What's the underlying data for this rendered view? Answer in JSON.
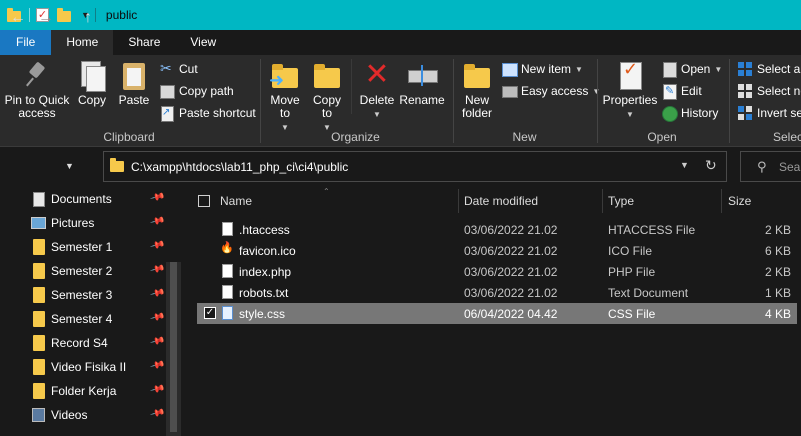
{
  "window": {
    "title": "public",
    "accent_color": "#00b7c3"
  },
  "tabs": [
    {
      "label": "File"
    },
    {
      "label": "Home"
    },
    {
      "label": "Share"
    },
    {
      "label": "View"
    }
  ],
  "ribbon": {
    "clipboard": {
      "label": "Clipboard",
      "pin": "Pin to Quick access",
      "copy": "Copy",
      "paste": "Paste",
      "cut": "Cut",
      "copy_path": "Copy path",
      "paste_shortcut": "Paste shortcut"
    },
    "organize": {
      "label": "Organize",
      "move_to": "Move to",
      "copy_to": "Copy to",
      "delete": "Delete",
      "rename": "Rename"
    },
    "new": {
      "label": "New",
      "new_folder": "New folder",
      "new_item": "New item",
      "easy_access": "Easy access"
    },
    "open": {
      "label": "Open",
      "properties": "Properties",
      "open": "Open",
      "edit": "Edit",
      "history": "History"
    },
    "select": {
      "label": "Select",
      "select_all": "Select all",
      "select_none": "Select none",
      "invert_selection": "Invert selection"
    }
  },
  "address": {
    "path": "C:\\xampp\\htdocs\\lab11_php_ci\\ci4\\public",
    "search_placeholder": "Search"
  },
  "sidebar": {
    "items": [
      {
        "label": "Documents",
        "icon": "documents-icon"
      },
      {
        "label": "Pictures",
        "icon": "pictures-icon"
      },
      {
        "label": "Semester 1",
        "icon": "folder-icon"
      },
      {
        "label": "Semester 2",
        "icon": "folder-icon"
      },
      {
        "label": "Semester 3",
        "icon": "folder-icon"
      },
      {
        "label": "Semester 4",
        "icon": "folder-icon"
      },
      {
        "label": "Record S4",
        "icon": "folder-icon"
      },
      {
        "label": "Video Fisika II",
        "icon": "folder-icon"
      },
      {
        "label": "Folder Kerja",
        "icon": "folder-icon"
      },
      {
        "label": "Videos",
        "icon": "videos-icon"
      }
    ]
  },
  "filelist": {
    "columns": {
      "name": "Name",
      "date": "Date modified",
      "type": "Type",
      "size": "Size"
    },
    "rows": [
      {
        "name": ".htaccess",
        "date": "03/06/2022 21.02",
        "type": "HTACCESS File",
        "size": "2 KB",
        "icon": "file-icon",
        "selected": false
      },
      {
        "name": "favicon.ico",
        "date": "03/06/2022 21.02",
        "type": "ICO File",
        "size": "6 KB",
        "icon": "ico-file-icon",
        "selected": false
      },
      {
        "name": "index.php",
        "date": "03/06/2022 21.02",
        "type": "PHP File",
        "size": "2 KB",
        "icon": "file-icon",
        "selected": false
      },
      {
        "name": "robots.txt",
        "date": "03/06/2022 21.02",
        "type": "Text Document",
        "size": "1 KB",
        "icon": "file-icon",
        "selected": false
      },
      {
        "name": "style.css",
        "date": "06/04/2022 04.42",
        "type": "CSS File",
        "size": "4 KB",
        "icon": "css-file-icon",
        "selected": true
      }
    ]
  }
}
